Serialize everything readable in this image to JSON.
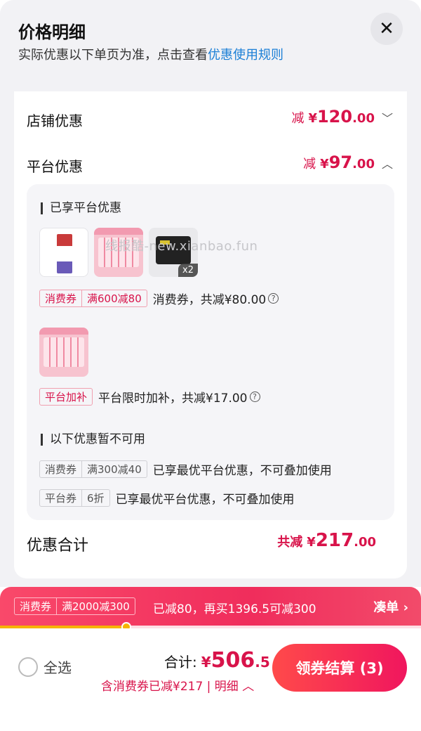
{
  "header": {
    "title": "价格明细",
    "subtitle_prefix": "实际优惠以下单页为准，点击查看",
    "subtitle_link": "优惠使用规则",
    "close_glyph": "✕"
  },
  "rows": {
    "store": {
      "label": "店铺优惠",
      "prefix": "减",
      "yen": "¥",
      "int": "120",
      "dec": ".00",
      "chevron": "﹀"
    },
    "platform": {
      "label": "平台优惠",
      "prefix": "减",
      "yen": "¥",
      "int": "97",
      "dec": ".00",
      "chevron": "︿"
    }
  },
  "platform_panel": {
    "enjoyed_title": "已享平台优惠",
    "coupon_tag": [
      "消费券",
      "满600减80"
    ],
    "coupon_text": "消费券，共减¥80.00",
    "subsidy_tag": [
      "平台加补"
    ],
    "subsidy_text": "平台限时加补，共减¥17.00",
    "thumb_qty": "x2",
    "unavailable_title": "以下优惠暂不可用",
    "unavailable": [
      {
        "tag": [
          "消费券",
          "满300减40"
        ],
        "text": "已享最优平台优惠，不可叠加使用"
      },
      {
        "tag": [
          "平台券",
          "6折"
        ],
        "text": "已享最优平台优惠，不可叠加使用"
      }
    ],
    "help_glyph": "?"
  },
  "watermark": "线报酷-new.xianbao.fun",
  "total": {
    "label": "优惠合计",
    "prefix": "共减",
    "yen": "¥",
    "int": "217",
    "dec": ".00"
  },
  "promo_bar": {
    "tag": [
      "消费券",
      "满2000减300"
    ],
    "message": "已减80，再买1396.5可减300",
    "action": "凑单 ›",
    "progress": 0.3
  },
  "footer": {
    "select_all": "全选",
    "sum_label": "合计:",
    "yen": "¥",
    "sum_int": "506",
    "sum_dec": ".5",
    "sum_note": "含消费券已减¥217 | 明细 ︿",
    "checkout_label": "领券结算 (3)"
  },
  "colors": {
    "accent": "#d8134a",
    "link": "#1b7fd6",
    "progress": "#f6b300"
  }
}
